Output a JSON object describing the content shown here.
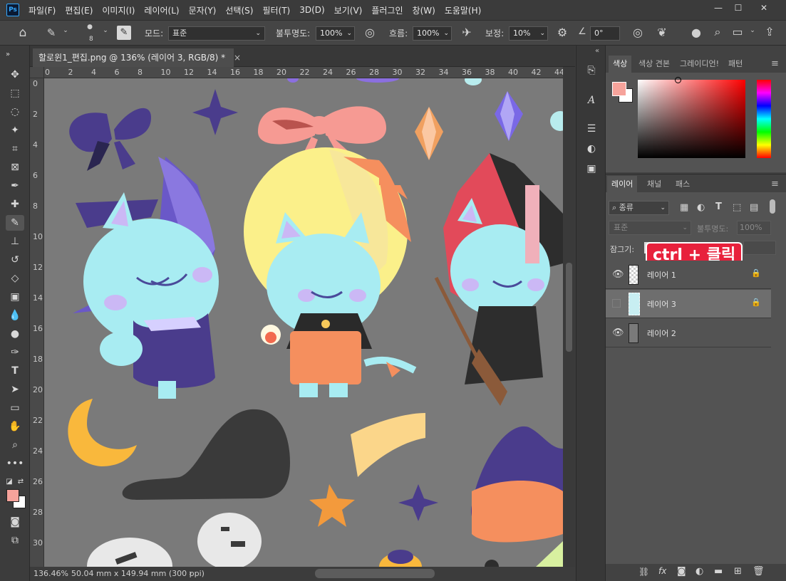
{
  "app": {
    "logo": "Ps"
  },
  "menu": [
    "파일(F)",
    "편집(E)",
    "이미지(I)",
    "레이어(L)",
    "문자(Y)",
    "선택(S)",
    "필터(T)",
    "3D(D)",
    "보기(V)",
    "플러그인",
    "창(W)",
    "도움말(H)"
  ],
  "window_controls": {
    "minimize": "—",
    "restore": "☐",
    "close": "✕"
  },
  "options": {
    "brush_size": "8",
    "mode_label": "모드:",
    "mode_value": "표준",
    "opacity_label": "불투명도:",
    "opacity_value": "100%",
    "flow_label": "흐름:",
    "flow_value": "100%",
    "smoothing_label": "보정:",
    "smoothing_value": "10%",
    "angle_value": "0°"
  },
  "document": {
    "tab_title": "할로윈1_편집.png @ 136% (레이어 3, RGB/8) *",
    "close": "×",
    "zoom": "136.46%",
    "doc_size": "50.04 mm x 149.94 mm (300 ppi)",
    "status_arrow": "›"
  },
  "ruler_top": [
    "0",
    "2",
    "4",
    "6",
    "8",
    "10",
    "12",
    "14",
    "16",
    "18",
    "20",
    "22",
    "24",
    "26",
    "28",
    "30",
    "32",
    "34",
    "36",
    "38",
    "40",
    "42",
    "44"
  ],
  "ruler_left": [
    "0",
    "2",
    "4",
    "6",
    "8",
    "10",
    "12",
    "14",
    "16",
    "18",
    "20",
    "22",
    "24",
    "26",
    "28",
    "30"
  ],
  "color_panel": {
    "tabs": [
      "색상",
      "색상 견본",
      "그레이디언!",
      "패턴"
    ],
    "fg_color": "#f6a39b",
    "bg_color": "#ffffff"
  },
  "layers_panel": {
    "tabs": [
      "레이어",
      "채널",
      "패스"
    ],
    "filter_label": "종류",
    "blend_mode": "표준",
    "opacity_label": "불투명도:",
    "opacity_value": "100%",
    "lock_label": "잠그기:",
    "layers": [
      {
        "name": "레이어 1",
        "visible": true,
        "locked": true,
        "selected": false
      },
      {
        "name": "레이어 3",
        "visible": false,
        "locked": true,
        "selected": true
      },
      {
        "name": "레이어 2",
        "visible": true,
        "locked": false,
        "selected": false
      }
    ],
    "annotation": "ctrl + 클릭",
    "footer_icons": [
      "link-icon",
      "fx-icon",
      "mask-icon",
      "adjustment-icon",
      "folder-icon",
      "new-layer-icon",
      "trash-icon"
    ],
    "fx_label": "fx"
  },
  "colors": {
    "canvas_bg": "#7a7a7a",
    "accent_red": "#e8213c",
    "cat_blue": "#a8ecf2"
  }
}
